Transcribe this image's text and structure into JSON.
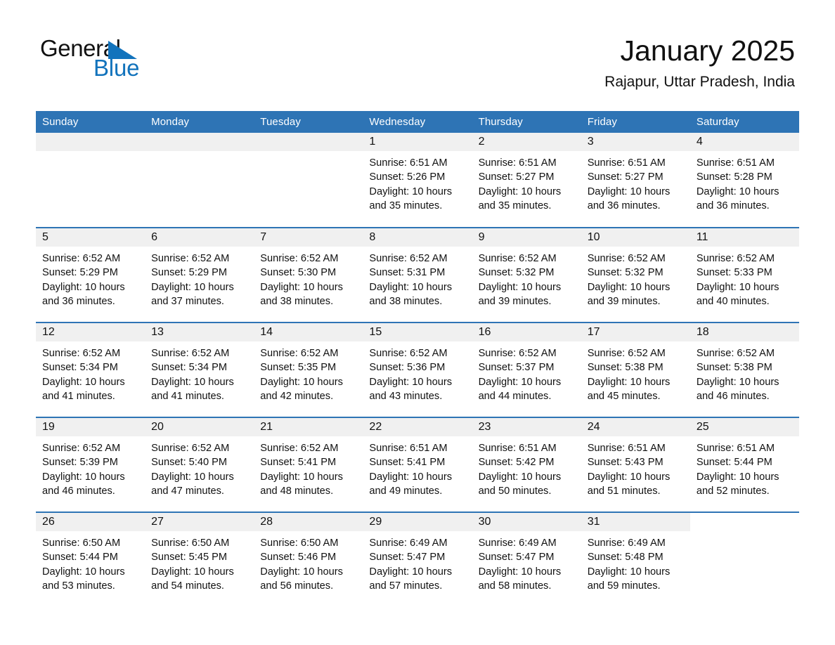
{
  "brand": {
    "name_part1": "General",
    "name_part2": "Blue",
    "logo_icon": "triangle-flag-icon",
    "accent_color": "#1273bc"
  },
  "header": {
    "title": "January 2025",
    "location": "Rajapur, Uttar Pradesh, India"
  },
  "theme": {
    "header_row_bg": "#2e74b5",
    "daynum_bg": "#f0f0f0",
    "row_divider": "#2e74b5",
    "text": "#111111"
  },
  "weekdays": [
    "Sunday",
    "Monday",
    "Tuesday",
    "Wednesday",
    "Thursday",
    "Friday",
    "Saturday"
  ],
  "labels": {
    "sunrise_prefix": "Sunrise:",
    "sunset_prefix": "Sunset:",
    "daylight_prefix": "Daylight:"
  },
  "weeks": [
    [
      {
        "day": "",
        "blank": true
      },
      {
        "day": "",
        "blank": true
      },
      {
        "day": "",
        "blank": true
      },
      {
        "day": "1",
        "sunrise": "Sunrise: 6:51 AM",
        "sunset": "Sunset: 5:26 PM",
        "daylight_line1": "Daylight: 10 hours",
        "daylight_line2": "and 35 minutes."
      },
      {
        "day": "2",
        "sunrise": "Sunrise: 6:51 AM",
        "sunset": "Sunset: 5:27 PM",
        "daylight_line1": "Daylight: 10 hours",
        "daylight_line2": "and 35 minutes."
      },
      {
        "day": "3",
        "sunrise": "Sunrise: 6:51 AM",
        "sunset": "Sunset: 5:27 PM",
        "daylight_line1": "Daylight: 10 hours",
        "daylight_line2": "and 36 minutes."
      },
      {
        "day": "4",
        "sunrise": "Sunrise: 6:51 AM",
        "sunset": "Sunset: 5:28 PM",
        "daylight_line1": "Daylight: 10 hours",
        "daylight_line2": "and 36 minutes."
      }
    ],
    [
      {
        "day": "5",
        "sunrise": "Sunrise: 6:52 AM",
        "sunset": "Sunset: 5:29 PM",
        "daylight_line1": "Daylight: 10 hours",
        "daylight_line2": "and 36 minutes."
      },
      {
        "day": "6",
        "sunrise": "Sunrise: 6:52 AM",
        "sunset": "Sunset: 5:29 PM",
        "daylight_line1": "Daylight: 10 hours",
        "daylight_line2": "and 37 minutes."
      },
      {
        "day": "7",
        "sunrise": "Sunrise: 6:52 AM",
        "sunset": "Sunset: 5:30 PM",
        "daylight_line1": "Daylight: 10 hours",
        "daylight_line2": "and 38 minutes."
      },
      {
        "day": "8",
        "sunrise": "Sunrise: 6:52 AM",
        "sunset": "Sunset: 5:31 PM",
        "daylight_line1": "Daylight: 10 hours",
        "daylight_line2": "and 38 minutes."
      },
      {
        "day": "9",
        "sunrise": "Sunrise: 6:52 AM",
        "sunset": "Sunset: 5:32 PM",
        "daylight_line1": "Daylight: 10 hours",
        "daylight_line2": "and 39 minutes."
      },
      {
        "day": "10",
        "sunrise": "Sunrise: 6:52 AM",
        "sunset": "Sunset: 5:32 PM",
        "daylight_line1": "Daylight: 10 hours",
        "daylight_line2": "and 39 minutes."
      },
      {
        "day": "11",
        "sunrise": "Sunrise: 6:52 AM",
        "sunset": "Sunset: 5:33 PM",
        "daylight_line1": "Daylight: 10 hours",
        "daylight_line2": "and 40 minutes."
      }
    ],
    [
      {
        "day": "12",
        "sunrise": "Sunrise: 6:52 AM",
        "sunset": "Sunset: 5:34 PM",
        "daylight_line1": "Daylight: 10 hours",
        "daylight_line2": "and 41 minutes."
      },
      {
        "day": "13",
        "sunrise": "Sunrise: 6:52 AM",
        "sunset": "Sunset: 5:34 PM",
        "daylight_line1": "Daylight: 10 hours",
        "daylight_line2": "and 41 minutes."
      },
      {
        "day": "14",
        "sunrise": "Sunrise: 6:52 AM",
        "sunset": "Sunset: 5:35 PM",
        "daylight_line1": "Daylight: 10 hours",
        "daylight_line2": "and 42 minutes."
      },
      {
        "day": "15",
        "sunrise": "Sunrise: 6:52 AM",
        "sunset": "Sunset: 5:36 PM",
        "daylight_line1": "Daylight: 10 hours",
        "daylight_line2": "and 43 minutes."
      },
      {
        "day": "16",
        "sunrise": "Sunrise: 6:52 AM",
        "sunset": "Sunset: 5:37 PM",
        "daylight_line1": "Daylight: 10 hours",
        "daylight_line2": "and 44 minutes."
      },
      {
        "day": "17",
        "sunrise": "Sunrise: 6:52 AM",
        "sunset": "Sunset: 5:38 PM",
        "daylight_line1": "Daylight: 10 hours",
        "daylight_line2": "and 45 minutes."
      },
      {
        "day": "18",
        "sunrise": "Sunrise: 6:52 AM",
        "sunset": "Sunset: 5:38 PM",
        "daylight_line1": "Daylight: 10 hours",
        "daylight_line2": "and 46 minutes."
      }
    ],
    [
      {
        "day": "19",
        "sunrise": "Sunrise: 6:52 AM",
        "sunset": "Sunset: 5:39 PM",
        "daylight_line1": "Daylight: 10 hours",
        "daylight_line2": "and 46 minutes."
      },
      {
        "day": "20",
        "sunrise": "Sunrise: 6:52 AM",
        "sunset": "Sunset: 5:40 PM",
        "daylight_line1": "Daylight: 10 hours",
        "daylight_line2": "and 47 minutes."
      },
      {
        "day": "21",
        "sunrise": "Sunrise: 6:52 AM",
        "sunset": "Sunset: 5:41 PM",
        "daylight_line1": "Daylight: 10 hours",
        "daylight_line2": "and 48 minutes."
      },
      {
        "day": "22",
        "sunrise": "Sunrise: 6:51 AM",
        "sunset": "Sunset: 5:41 PM",
        "daylight_line1": "Daylight: 10 hours",
        "daylight_line2": "and 49 minutes."
      },
      {
        "day": "23",
        "sunrise": "Sunrise: 6:51 AM",
        "sunset": "Sunset: 5:42 PM",
        "daylight_line1": "Daylight: 10 hours",
        "daylight_line2": "and 50 minutes."
      },
      {
        "day": "24",
        "sunrise": "Sunrise: 6:51 AM",
        "sunset": "Sunset: 5:43 PM",
        "daylight_line1": "Daylight: 10 hours",
        "daylight_line2": "and 51 minutes."
      },
      {
        "day": "25",
        "sunrise": "Sunrise: 6:51 AM",
        "sunset": "Sunset: 5:44 PM",
        "daylight_line1": "Daylight: 10 hours",
        "daylight_line2": "and 52 minutes."
      }
    ],
    [
      {
        "day": "26",
        "sunrise": "Sunrise: 6:50 AM",
        "sunset": "Sunset: 5:44 PM",
        "daylight_line1": "Daylight: 10 hours",
        "daylight_line2": "and 53 minutes."
      },
      {
        "day": "27",
        "sunrise": "Sunrise: 6:50 AM",
        "sunset": "Sunset: 5:45 PM",
        "daylight_line1": "Daylight: 10 hours",
        "daylight_line2": "and 54 minutes."
      },
      {
        "day": "28",
        "sunrise": "Sunrise: 6:50 AM",
        "sunset": "Sunset: 5:46 PM",
        "daylight_line1": "Daylight: 10 hours",
        "daylight_line2": "and 56 minutes."
      },
      {
        "day": "29",
        "sunrise": "Sunrise: 6:49 AM",
        "sunset": "Sunset: 5:47 PM",
        "daylight_line1": "Daylight: 10 hours",
        "daylight_line2": "and 57 minutes."
      },
      {
        "day": "30",
        "sunrise": "Sunrise: 6:49 AM",
        "sunset": "Sunset: 5:47 PM",
        "daylight_line1": "Daylight: 10 hours",
        "daylight_line2": "and 58 minutes."
      },
      {
        "day": "31",
        "sunrise": "Sunrise: 6:49 AM",
        "sunset": "Sunset: 5:48 PM",
        "daylight_line1": "Daylight: 10 hours",
        "daylight_line2": "and 59 minutes."
      },
      {
        "day": "",
        "void": true
      }
    ]
  ]
}
